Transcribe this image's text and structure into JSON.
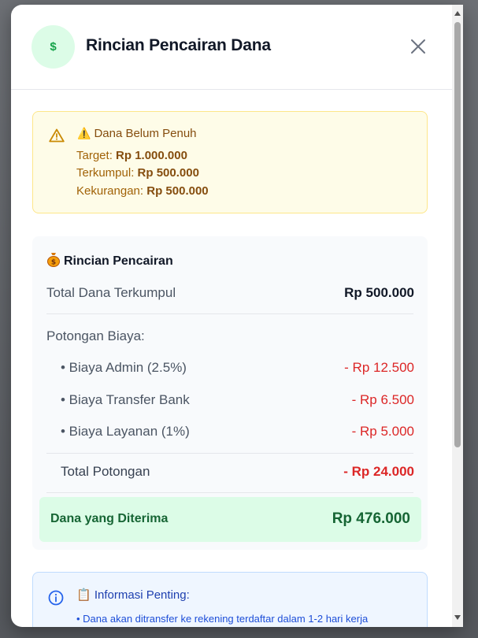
{
  "modal": {
    "icon_symbol": "$",
    "title": "Rincian Pencairan Dana"
  },
  "warning": {
    "emoji": "⚠️",
    "title": "Dana Belum Penuh",
    "target_label": "Target:",
    "target_value": "Rp 1.000.000",
    "collected_label": "Terkumpul:",
    "collected_value": "Rp 500.000",
    "shortfall_label": "Kekurangan:",
    "shortfall_value": "Rp 500.000"
  },
  "details": {
    "title": "Rincian Pencairan",
    "total_collected_label": "Total Dana Terkumpul",
    "total_collected_value": "Rp 500.000",
    "deductions_label": "Potongan Biaya:",
    "deductions": [
      {
        "label": "• Biaya Admin (2.5%)",
        "value": "- Rp 12.500"
      },
      {
        "label": "• Biaya Transfer Bank",
        "value": "- Rp 6.500"
      },
      {
        "label": "• Biaya Layanan (1%)",
        "value": "- Rp 5.000"
      }
    ],
    "total_deduction_label": "Total Potongan",
    "total_deduction_value": "- Rp 24.000",
    "received_label": "Dana yang Diterima",
    "received_value": "Rp 476.000"
  },
  "info": {
    "emoji": "📋",
    "title": "Informasi Penting:",
    "items": [
      "• Dana akan ditransfer ke rekening terdaftar dalam 1-2 hari kerja"
    ]
  },
  "colors": {
    "accent_green": "#16a34a",
    "warning_bg": "#fefce8",
    "danger_red": "#dc2626",
    "info_blue": "#1e40af"
  },
  "icons": {
    "header": "dollar-icon",
    "close": "close-icon",
    "warning": "warning-triangle-icon",
    "money_bag": "money-bag-icon",
    "info": "info-circle-icon"
  }
}
